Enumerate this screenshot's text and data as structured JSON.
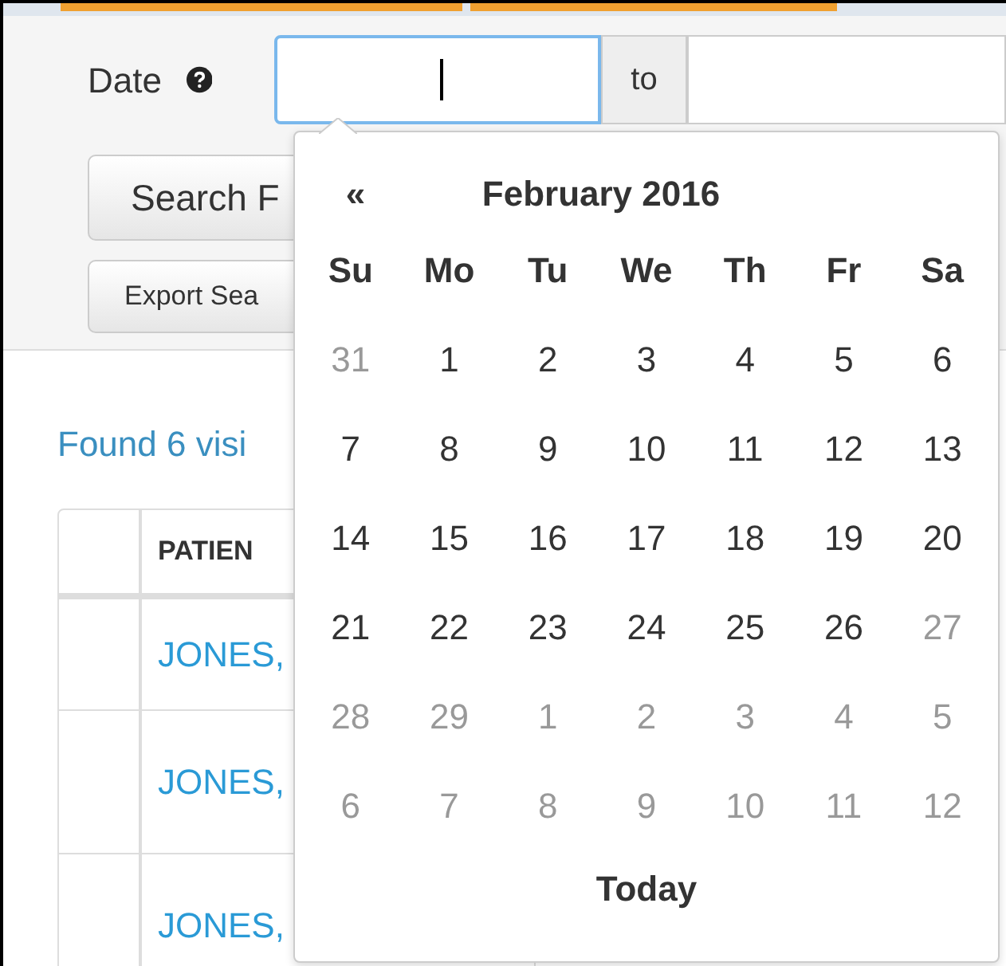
{
  "filter": {
    "date_label": "Date",
    "range_separator": "to",
    "buttons": [
      "Search F",
      "Export Sea"
    ]
  },
  "results": {
    "summary": "Found 6 visi",
    "columns": [
      "",
      "PATIEN"
    ],
    "rows": [
      {
        "patient": "JONES,"
      },
      {
        "patient": "JONES,"
      },
      {
        "patient": "JONES,"
      }
    ]
  },
  "datepicker": {
    "prev": "«",
    "title": "February 2016",
    "weekdays": [
      "Su",
      "Mo",
      "Tu",
      "We",
      "Th",
      "Fr",
      "Sa"
    ],
    "weeks": [
      [
        {
          "label": "31",
          "muted": true
        },
        {
          "label": "1",
          "muted": false
        },
        {
          "label": "2",
          "muted": false
        },
        {
          "label": "3",
          "muted": false
        },
        {
          "label": "4",
          "muted": false
        },
        {
          "label": "5",
          "muted": false
        },
        {
          "label": "6",
          "muted": false
        }
      ],
      [
        {
          "label": "7",
          "muted": false
        },
        {
          "label": "8",
          "muted": false
        },
        {
          "label": "9",
          "muted": false
        },
        {
          "label": "10",
          "muted": false
        },
        {
          "label": "11",
          "muted": false
        },
        {
          "label": "12",
          "muted": false
        },
        {
          "label": "13",
          "muted": false
        }
      ],
      [
        {
          "label": "14",
          "muted": false
        },
        {
          "label": "15",
          "muted": false
        },
        {
          "label": "16",
          "muted": false
        },
        {
          "label": "17",
          "muted": false
        },
        {
          "label": "18",
          "muted": false
        },
        {
          "label": "19",
          "muted": false
        },
        {
          "label": "20",
          "muted": false
        }
      ],
      [
        {
          "label": "21",
          "muted": false
        },
        {
          "label": "22",
          "muted": false
        },
        {
          "label": "23",
          "muted": false
        },
        {
          "label": "24",
          "muted": false
        },
        {
          "label": "25",
          "muted": false
        },
        {
          "label": "26",
          "muted": false
        },
        {
          "label": "27",
          "muted": true
        }
      ],
      [
        {
          "label": "28",
          "muted": true
        },
        {
          "label": "29",
          "muted": true
        },
        {
          "label": "1",
          "muted": true
        },
        {
          "label": "2",
          "muted": true
        },
        {
          "label": "3",
          "muted": true
        },
        {
          "label": "4",
          "muted": true
        },
        {
          "label": "5",
          "muted": true
        }
      ],
      [
        {
          "label": "6",
          "muted": true
        },
        {
          "label": "7",
          "muted": true
        },
        {
          "label": "8",
          "muted": true
        },
        {
          "label": "9",
          "muted": true
        },
        {
          "label": "10",
          "muted": true
        },
        {
          "label": "11",
          "muted": true
        },
        {
          "label": "12",
          "muted": true
        }
      ]
    ],
    "today": "Today"
  }
}
